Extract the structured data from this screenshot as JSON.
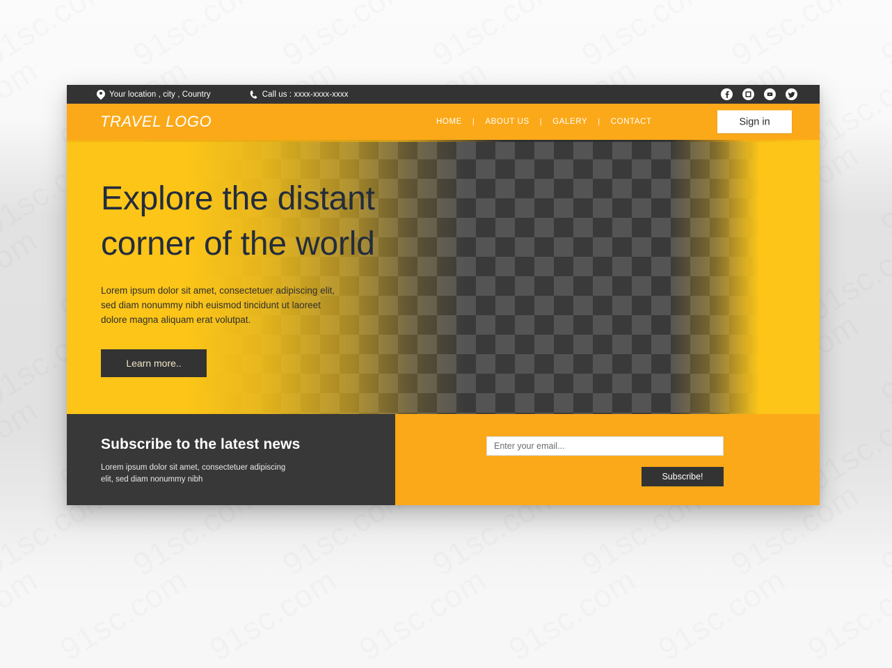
{
  "topbar": {
    "location": "Your location , city , Country",
    "phone": "Call us : xxxx-xxxx-xxxx",
    "socials": [
      {
        "name": "facebook-icon",
        "label": "Facebook"
      },
      {
        "name": "instagram-icon",
        "label": "Instagram"
      },
      {
        "name": "youtube-icon",
        "label": "YouTube"
      },
      {
        "name": "twitter-icon",
        "label": "Twitter"
      }
    ]
  },
  "nav": {
    "logo": "TRAVEL LOGO",
    "separator": "|",
    "items": [
      {
        "label": "HOME"
      },
      {
        "label": "ABOUT US"
      },
      {
        "label": "GALERY"
      },
      {
        "label": "CONTACT"
      }
    ],
    "signin_label": "Sign in"
  },
  "hero": {
    "headline_line1": "Explore the distant",
    "headline_line2": "corner of the world",
    "paragraph_line1": "Lorem ipsum dolor sit amet, consectetuer adipiscing elit,",
    "paragraph_line2": "sed diam nonummy nibh euismod tincidunt ut laoreet",
    "paragraph_line3": "dolore magna aliquam erat volutpat.",
    "cta_label": "Learn more.."
  },
  "subscribe": {
    "title": "Subscribe to the latest news",
    "desc_line1": "Lorem ipsum dolor sit amet, consectetuer adipiscing",
    "desc_line2": "elit, sed diam nonummy nibh",
    "email_placeholder": "Enter your email...",
    "email_value": "",
    "button_label": "Subscribe!"
  },
  "watermark": {
    "text": "91sc.com"
  },
  "colors": {
    "orange": "#fba919",
    "yellow": "#fcc518",
    "dark": "#333333",
    "dark_footer": "#383838",
    "headline": "#232c3d",
    "white": "#ffffff"
  }
}
